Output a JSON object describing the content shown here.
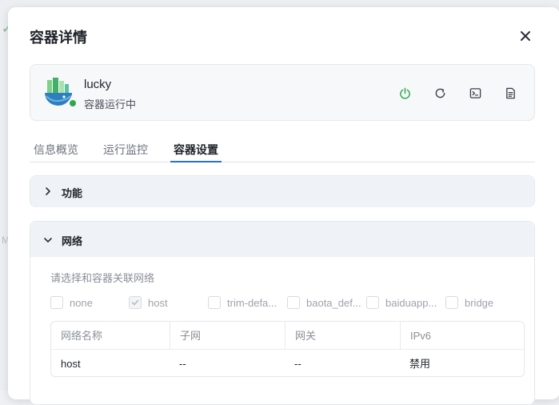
{
  "dialog": {
    "title": "容器详情",
    "close_icon": "close-icon"
  },
  "app": {
    "name": "lucky",
    "status": "容器运行中",
    "status_color": "#2ea84f",
    "actions": [
      {
        "icon": "power-icon",
        "color": "#2ea84f"
      },
      {
        "icon": "restart-icon",
        "color": "#4b5058"
      },
      {
        "icon": "terminal-icon",
        "color": "#4b5058"
      },
      {
        "icon": "log-document-icon",
        "color": "#4b5058"
      }
    ]
  },
  "tabs": [
    {
      "label": "信息概览",
      "active": false
    },
    {
      "label": "运行监控",
      "active": false
    },
    {
      "label": "容器设置",
      "active": true
    }
  ],
  "accent_color": "#2a6fdb",
  "sections": {
    "features": {
      "title": "功能",
      "expanded": false
    },
    "network": {
      "title": "网络",
      "expanded": true,
      "prompt": "请选择和容器关联网络",
      "options": [
        {
          "label": "none",
          "checked": false
        },
        {
          "label": "host",
          "checked": true
        },
        {
          "label": "trim-defa...",
          "checked": false
        },
        {
          "label": "baota_def...",
          "checked": false
        },
        {
          "label": "baiduapp...",
          "checked": false
        },
        {
          "label": "bridge",
          "checked": false
        }
      ],
      "table": {
        "headers": [
          "网络名称",
          "子网",
          "网关",
          "IPv6"
        ],
        "rows": [
          [
            "host",
            "--",
            "--",
            "禁用"
          ]
        ]
      }
    }
  }
}
